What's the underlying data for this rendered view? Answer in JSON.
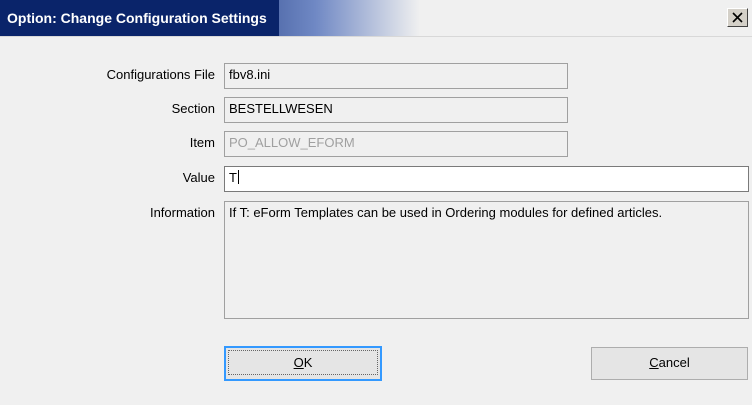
{
  "window": {
    "title": "Option: Change Configuration Settings",
    "close_glyph": "X"
  },
  "form": {
    "config_file": {
      "label": "Configurations File",
      "value": "fbv8.ini"
    },
    "section": {
      "label": "Section",
      "value": "BESTELLWESEN"
    },
    "item": {
      "label": "Item",
      "value": "PO_ALLOW_EFORM"
    },
    "value": {
      "label": "Value",
      "value": "T"
    },
    "information": {
      "label": "Information",
      "value": "If T: eForm Templates can be used in Ordering modules for defined articles."
    }
  },
  "buttons": {
    "ok": {
      "mnemonic": "O",
      "rest": "K"
    },
    "cancel": {
      "mnemonic": "C",
      "rest": "ancel"
    }
  }
}
